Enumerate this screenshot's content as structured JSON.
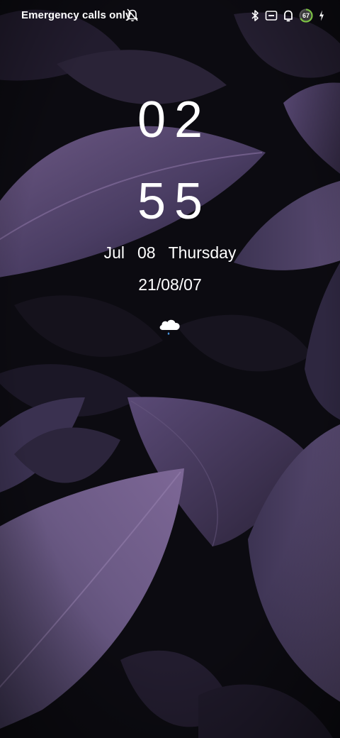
{
  "status_bar": {
    "carrier_text": "Emergency calls only",
    "icons": [
      "alarm-off-icon",
      "bluetooth-icon",
      "nfc-icon",
      "ringer-icon",
      "battery-icon",
      "charging-icon"
    ],
    "battery_level": "67",
    "battery_color": "#7bc043"
  },
  "lock_screen": {
    "hours": "02",
    "minutes": "55",
    "month": "Jul",
    "day": "08",
    "weekday": "Thursday",
    "numeric_date": "21/08/07",
    "weather_icon": "cloud-rain-icon"
  }
}
